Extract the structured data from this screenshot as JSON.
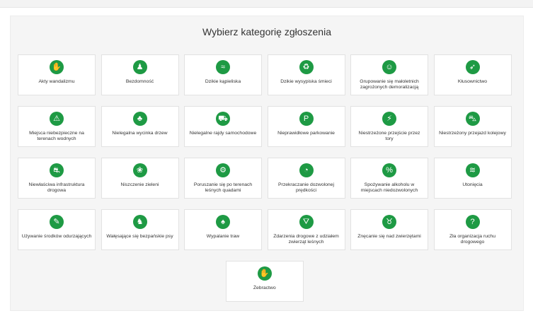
{
  "title": "Wybierz kategorię zgłoszenia",
  "colors": {
    "accent": "#1e9a44"
  },
  "categories": [
    {
      "label": "Akty wandalizmu",
      "icon": "vandalism-icon",
      "glyph": "✋"
    },
    {
      "label": "Bezdomność",
      "icon": "homeless-icon",
      "glyph": "♟"
    },
    {
      "label": "Dzikie kąpieliska",
      "icon": "swimmer-icon",
      "glyph": "≈"
    },
    {
      "label": "Dzikie wysypiska śmieci",
      "icon": "trash-icon",
      "glyph": "♻"
    },
    {
      "label": "Grupowanie się małoletnich zagrożonych demoralizacją",
      "icon": "group-icon",
      "glyph": "☺"
    },
    {
      "label": "Kłusownictwo",
      "icon": "poaching-icon",
      "glyph": "➶"
    },
    {
      "label": "Miejsca niebezpieczne na terenach wodnych",
      "icon": "water-danger-icon",
      "glyph": "⚠"
    },
    {
      "label": "Nielegalna wycinka drzew",
      "icon": "tree-cutting-icon",
      "glyph": "♣"
    },
    {
      "label": "Nielegalne rajdy samochodowe",
      "icon": "car-rally-icon",
      "glyph": "⛟"
    },
    {
      "label": "Nieprawidłowe parkowanie",
      "icon": "parking-icon",
      "glyph": "P"
    },
    {
      "label": "Niestrzeżone przejście przez tory",
      "icon": "rail-crossing-icon",
      "glyph": "⚡"
    },
    {
      "label": "Niestrzeżony przejazd kolejowy",
      "icon": "train-icon",
      "glyph": "⛍"
    },
    {
      "label": "Niewłaściwa infrastruktura drogowa",
      "icon": "road-infrastructure-icon",
      "glyph": "⛐"
    },
    {
      "label": "Niszczenie zieleni",
      "icon": "greenery-icon",
      "glyph": "❀"
    },
    {
      "label": "Poruszanie się po terenach leśnych quadami",
      "icon": "quad-icon",
      "glyph": "⚙"
    },
    {
      "label": "Przekraczanie dozwolonej prędkości",
      "icon": "speed-icon",
      "glyph": "◔"
    },
    {
      "label": "Spożywanie alkoholu w miejscach niedozwolonych",
      "icon": "alcohol-icon",
      "glyph": "%"
    },
    {
      "label": "Utonięcia",
      "icon": "drowning-icon",
      "glyph": "≋"
    },
    {
      "label": "Używanie środków odurzających",
      "icon": "drugs-icon",
      "glyph": "✎"
    },
    {
      "label": "Wałęsające się bezpańskie psy",
      "icon": "dog-icon",
      "glyph": "♞"
    },
    {
      "label": "Wypalanie traw",
      "icon": "grass-burning-icon",
      "glyph": "♠"
    },
    {
      "label": "Zdarzenia drogowe z udziałem zwierząt leśnych",
      "icon": "animal-road-icon",
      "glyph": "⛛"
    },
    {
      "label": "Znęcanie się nad zwierzętami",
      "icon": "animal-abuse-icon",
      "glyph": "♉"
    },
    {
      "label": "Zła organizacja ruchu drogowego",
      "icon": "traffic-icon",
      "glyph": "?"
    },
    {
      "label": "Żebractwo",
      "icon": "begging-icon",
      "glyph": "✋"
    }
  ]
}
